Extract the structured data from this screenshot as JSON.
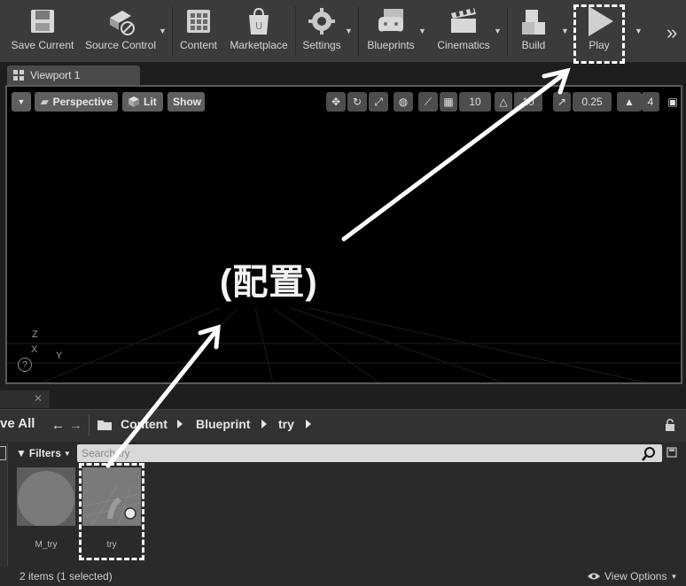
{
  "toolbar": {
    "buttons": [
      {
        "label": "Save Current"
      },
      {
        "label": "Source Control"
      },
      {
        "label": "Content"
      },
      {
        "label": "Marketplace"
      },
      {
        "label": "Settings"
      },
      {
        "label": "Blueprints"
      },
      {
        "label": "Cinematics"
      },
      {
        "label": "Build"
      },
      {
        "label": "Play"
      }
    ],
    "overflow": "»"
  },
  "viewport": {
    "tab_label": "Viewport 1",
    "view_mode": "Perspective",
    "lighting": "Lit",
    "show": "Show",
    "grid_snap": "10",
    "rotation_snap": "10",
    "scale_snap": "0.25",
    "camera_speed": "4",
    "axis": {
      "z": "Z",
      "x": "X",
      "y": "Y"
    }
  },
  "annotation": {
    "text": "(配置)"
  },
  "content_browser": {
    "save_all": "ve All",
    "breadcrumb": [
      "Content",
      "Blueprint",
      "try"
    ],
    "filters": "Filters",
    "search_placeholder": "Search try",
    "assets": [
      {
        "label": "M_try"
      },
      {
        "label": "try"
      }
    ],
    "status": "2 items (1 selected)",
    "view_options": "View Options"
  },
  "colors": {
    "highlight": "#ffffff",
    "viewport_bg": "#000000",
    "toolbar_bg": "#3b3b3b"
  }
}
